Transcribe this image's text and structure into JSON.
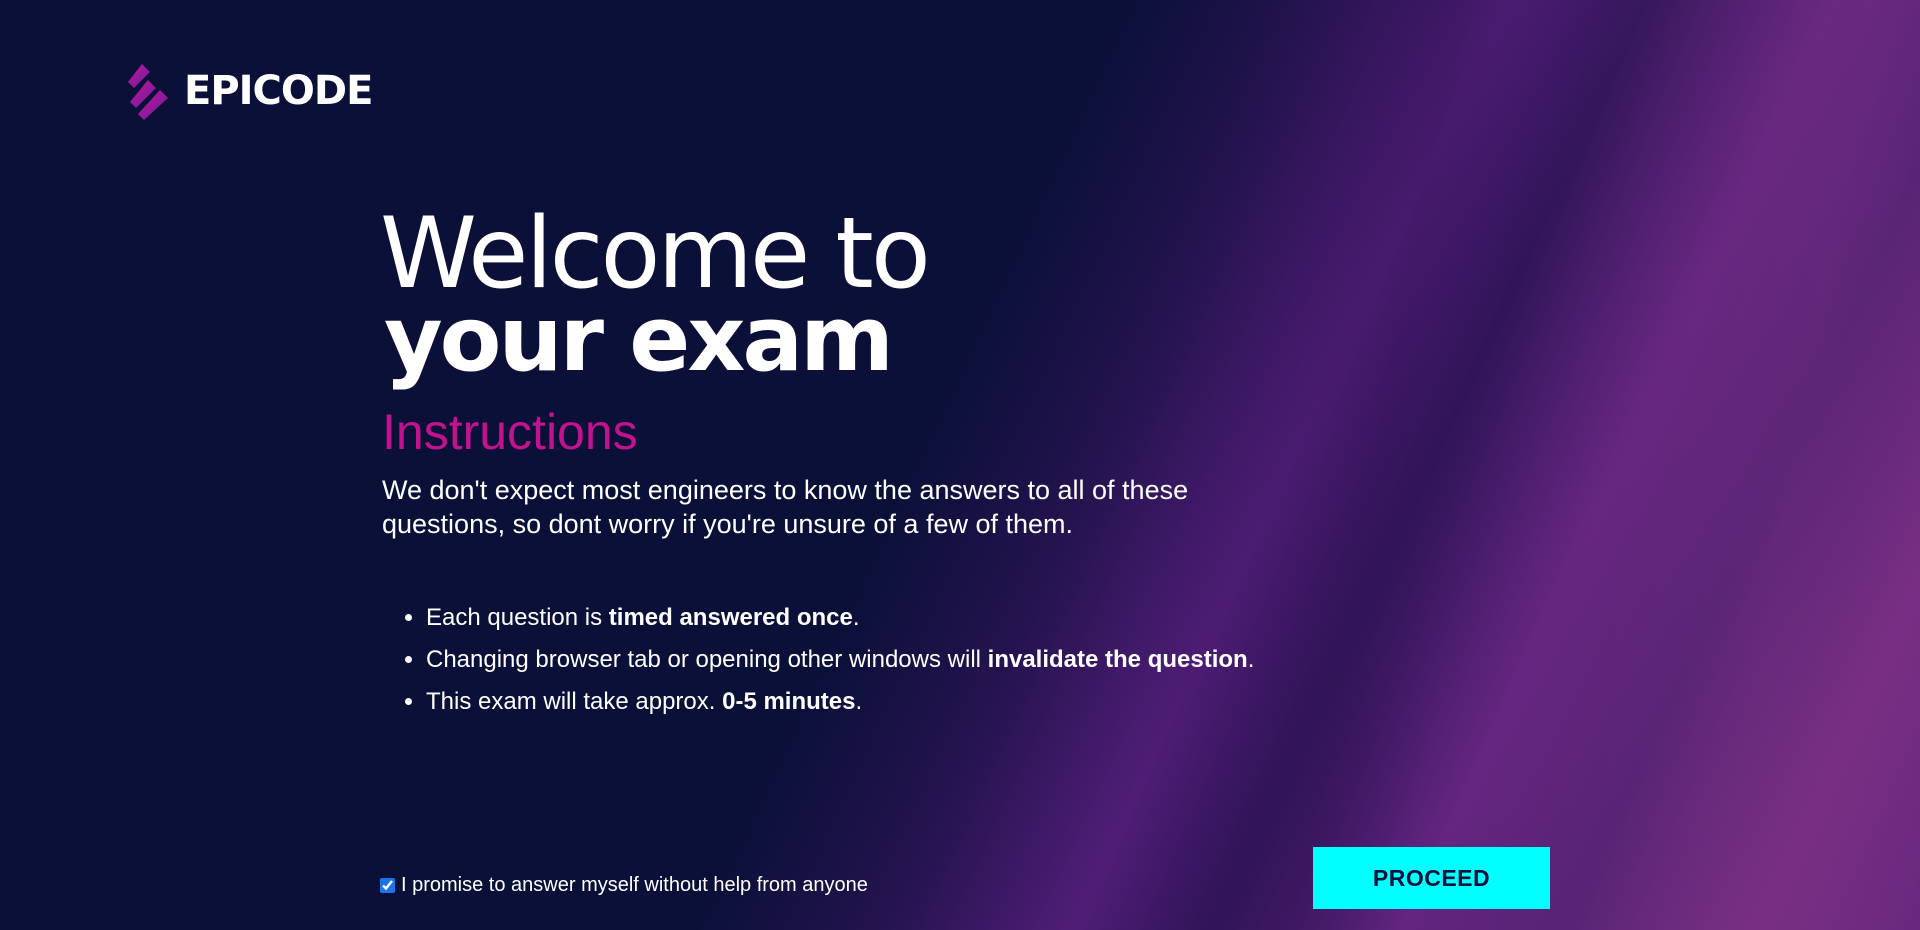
{
  "brand": {
    "name": "EPICODE",
    "accent": "#c2128d",
    "logo_icon": "epicode-stripes-icon"
  },
  "hero": {
    "line1": "Welcome to",
    "line2": "your exam"
  },
  "instructions": {
    "heading": "Instructions",
    "intro": "We don't expect most engineers to know the answers to all of these questions, so dont worry if you're unsure of a few of them.",
    "rules": [
      {
        "before": "Each question is ",
        "bold": "timed answered once",
        "after": "."
      },
      {
        "before": "Changing browser tab or opening other windows will ",
        "bold": "invalidate the question",
        "after": "."
      },
      {
        "before": "This exam will take approx. ",
        "bold": "0-5 minutes",
        "after": "."
      }
    ]
  },
  "promise": {
    "label": "I promise to answer myself without help from anyone",
    "checked": true
  },
  "proceed": {
    "label": "PROCEED",
    "color": "#00ffff"
  }
}
